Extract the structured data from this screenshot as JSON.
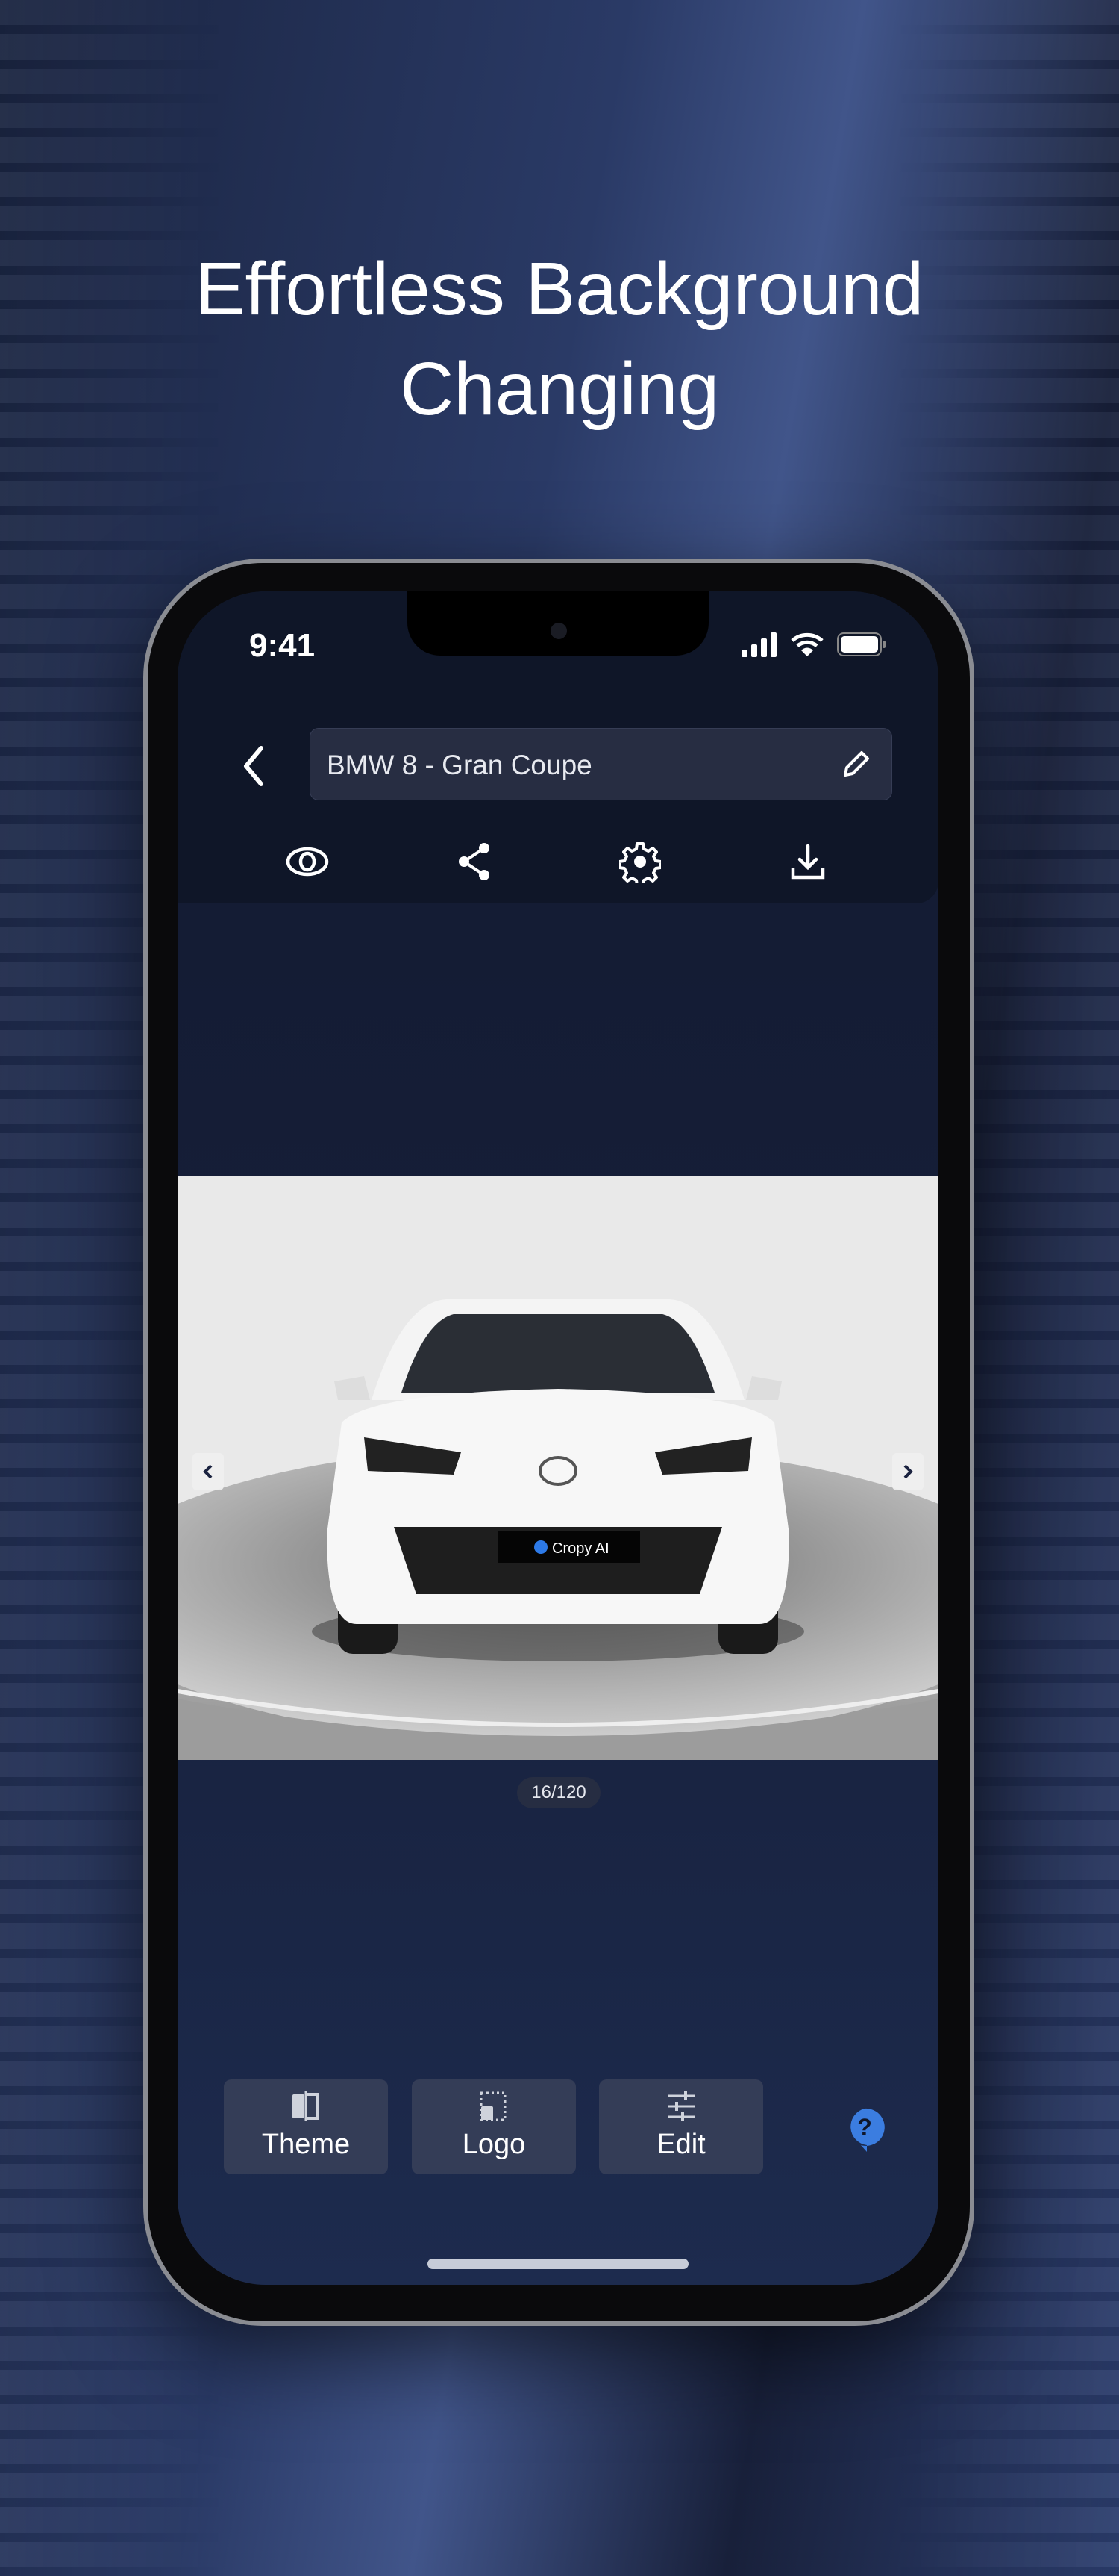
{
  "headline": {
    "line1": "Effortless Background",
    "line2": "Changing"
  },
  "status_bar": {
    "time": "9:41"
  },
  "header": {
    "project_title": "BMW 8 - Gran Coupe",
    "back_icon": "chevron-left-icon",
    "edit_icon": "pencil-icon"
  },
  "toolbar": {
    "icons": [
      "eye-icon",
      "share-icon",
      "gear-icon",
      "download-icon"
    ]
  },
  "viewer": {
    "plate_text": "Cropy AI",
    "counter": "16/120",
    "current": 16,
    "total": 120
  },
  "bottom_bar": {
    "buttons": [
      {
        "label": "Theme",
        "icon": "theme-icon"
      },
      {
        "label": "Logo",
        "icon": "logo-icon"
      },
      {
        "label": "Edit",
        "icon": "sliders-icon"
      }
    ],
    "help_icon": "help-icon"
  },
  "colors": {
    "accent": "#3b7de0",
    "panel": "#343d57",
    "background": "#161f3a"
  }
}
